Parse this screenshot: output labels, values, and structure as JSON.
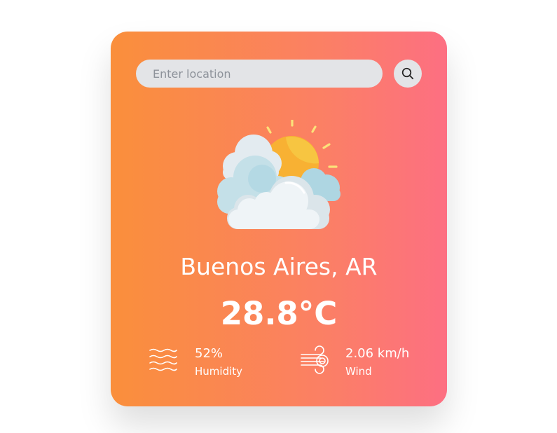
{
  "search": {
    "placeholder": "Enter location",
    "value": "",
    "button_icon": "search-icon"
  },
  "weather": {
    "icon": "partly-cloudy-sun-icon",
    "city": "Buenos Aires, AR",
    "temperature": "28.8°C"
  },
  "humidity": {
    "icon": "humidity-waves-icon",
    "value": "52%",
    "label": "Humidity"
  },
  "wind": {
    "icon": "wind-icon",
    "value": "2.06 km/h",
    "label": "Wind"
  },
  "colors": {
    "gradient_start": "#fa8f3b",
    "gradient_end": "#fd6f82",
    "text": "#ffffff",
    "input_bg": "#e3e4e7"
  }
}
